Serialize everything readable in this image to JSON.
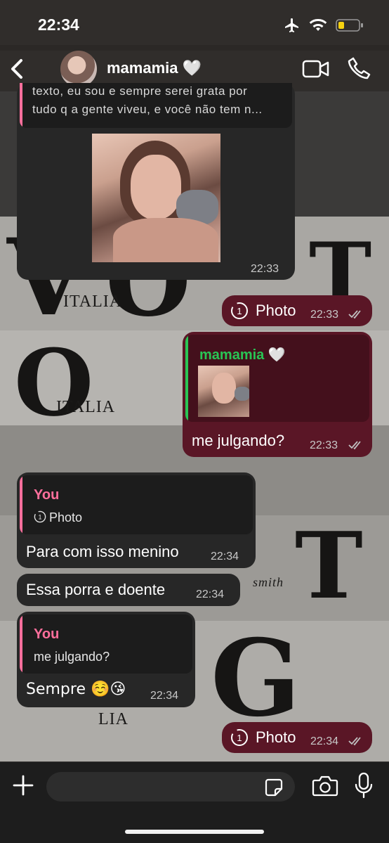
{
  "status_bar": {
    "time": "22:34"
  },
  "header": {
    "contact_name": "mamamia 🤍"
  },
  "wallpaper": {
    "texts": [
      "ITALIA",
      "ITALIA",
      "smith",
      "LIA"
    ]
  },
  "messages": [
    {
      "id": "m1",
      "direction": "in",
      "quoted_text_line1": "texto, eu sou e sempre serei grata por",
      "quoted_text_line2": "tudo q a gente viveu, e você não tem n...",
      "time": "22:33"
    },
    {
      "id": "m2",
      "direction": "out",
      "label": "Photo",
      "time": "22:33"
    },
    {
      "id": "m3",
      "direction": "out",
      "quote_author": "mamamia 🤍",
      "text": "me julgando?",
      "time": "22:33"
    },
    {
      "id": "m4",
      "direction": "in",
      "quote_author": "You",
      "quote_text": "Photo",
      "text": "Para com isso menino",
      "time": "22:34"
    },
    {
      "id": "m5",
      "direction": "in",
      "text": "Essa porra e doente",
      "time": "22:34"
    },
    {
      "id": "m6",
      "direction": "in",
      "quote_author": "You",
      "quote_text": "me julgando?",
      "text": "Sempre ☺️😘",
      "time": "22:34"
    },
    {
      "id": "m7",
      "direction": "out",
      "label": "Photo",
      "time": "22:34"
    }
  ],
  "input": {
    "placeholder": ""
  },
  "colors": {
    "outgoing_bubble": "#5a1626",
    "incoming_bubble": "#272727",
    "quote_you": "#ff6f9c",
    "quote_contact": "#29c454"
  }
}
